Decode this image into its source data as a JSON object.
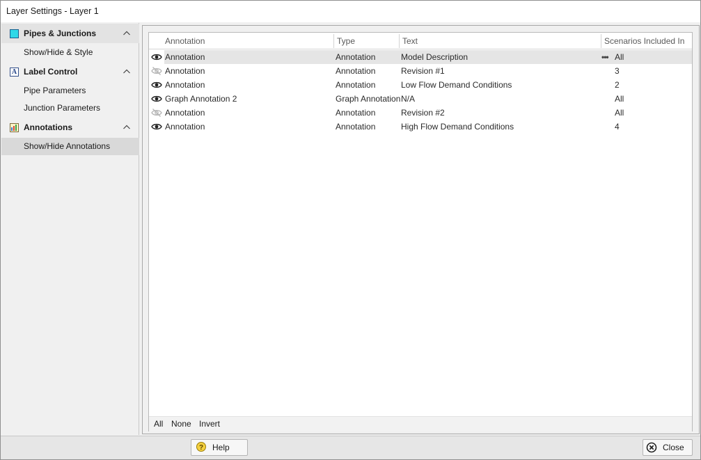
{
  "window": {
    "title": "Layer Settings - Layer 1"
  },
  "sidebar": {
    "sections": [
      {
        "label": "Pipes & Junctions",
        "icon": "cyan-square-icon",
        "items": [
          "Show/Hide & Style"
        ]
      },
      {
        "label": "Label Control",
        "icon": "label-a-icon",
        "items": [
          "Pipe Parameters",
          "Junction Parameters"
        ]
      },
      {
        "label": "Annotations",
        "icon": "annotation-image-icon",
        "items": [
          "Show/Hide Annotations"
        ]
      }
    ],
    "selected_item": "Show/Hide Annotations"
  },
  "table": {
    "columns": [
      "Annotation",
      "Type",
      "Text",
      "Scenarios Included In"
    ],
    "rows": [
      {
        "visible": true,
        "annotation": "Annotation",
        "type": "Annotation",
        "text": "Model Description",
        "scenarios": "All",
        "selected": true
      },
      {
        "visible": false,
        "annotation": "Annotation",
        "type": "Annotation",
        "text": "Revision #1",
        "scenarios": "3",
        "selected": false
      },
      {
        "visible": true,
        "annotation": "Annotation",
        "type": "Annotation",
        "text": "Low Flow Demand Conditions",
        "scenarios": "2",
        "selected": false
      },
      {
        "visible": true,
        "annotation": "Graph Annotation 2",
        "type": "Graph Annotation",
        "text": "N/A",
        "scenarios": "All",
        "selected": false
      },
      {
        "visible": false,
        "annotation": "Annotation",
        "type": "Annotation",
        "text": "Revision #2",
        "scenarios": "All",
        "selected": false
      },
      {
        "visible": true,
        "annotation": "Annotation",
        "type": "Annotation",
        "text": "High Flow Demand Conditions",
        "scenarios": "4",
        "selected": false
      }
    ],
    "footer": {
      "all": "All",
      "none": "None",
      "invert": "Invert"
    }
  },
  "buttons": {
    "help": "Help",
    "close": "Close"
  }
}
